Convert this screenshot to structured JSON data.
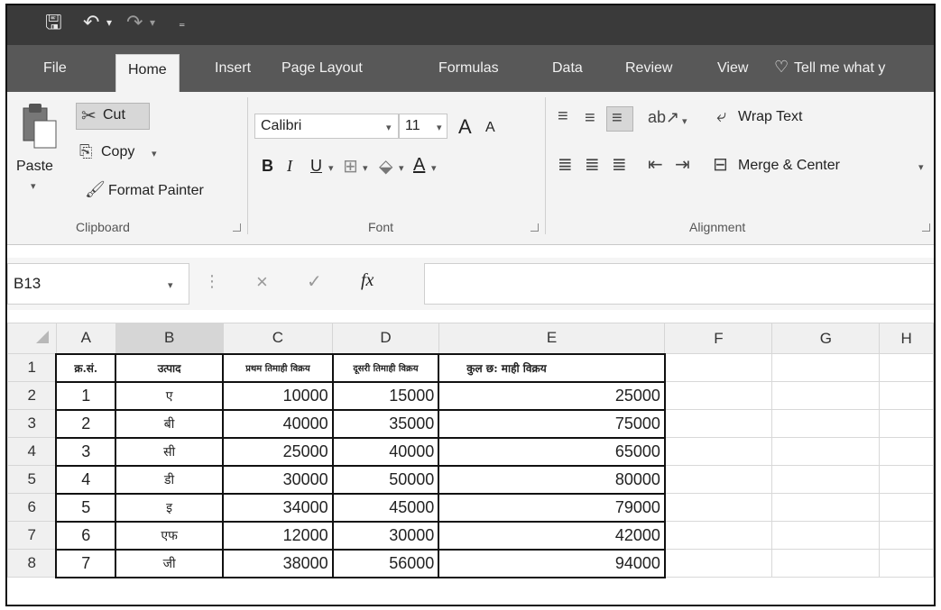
{
  "quick_access": {
    "save_icon": "save-icon",
    "undo_icon": "undo-icon",
    "redo_icon": "redo-icon",
    "customize_icon": "customize-icon"
  },
  "tabs": [
    "File",
    "Home",
    "Insert",
    "Page Layout",
    "Formulas",
    "Data",
    "Review",
    "View"
  ],
  "tell_me": "Tell me what y",
  "clipboard": {
    "paste": "Paste",
    "cut": "Cut",
    "copy": "Copy",
    "format_painter": "Format Painter",
    "label": "Clipboard"
  },
  "font": {
    "name": "Calibri",
    "size": "11",
    "grow": "A",
    "shrink": "A",
    "bold": "B",
    "italic": "I",
    "underline": "U",
    "font_color": "A",
    "label": "Font"
  },
  "alignment": {
    "wrap_text": "Wrap Text",
    "merge_center": "Merge & Center",
    "label": "Alignment"
  },
  "formula_bar": {
    "name_box": "B13",
    "fx": "fx",
    "cancel": "×",
    "enter": "✓",
    "value": ""
  },
  "columns": [
    "A",
    "B",
    "C",
    "D",
    "E",
    "F",
    "G",
    "H"
  ],
  "selected_column": "B",
  "rows": [
    {
      "num": "1",
      "cells": [
        "क्र.सं.",
        "उत्पाद",
        "प्रथम तिमाही विक्रय",
        "दूसरी तिमाही विक्रय",
        "कुल छ: माही विक्रय"
      ]
    },
    {
      "num": "2",
      "cells": [
        "1",
        "ए",
        "10000",
        "15000",
        "25000"
      ]
    },
    {
      "num": "3",
      "cells": [
        "2",
        "बी",
        "40000",
        "35000",
        "75000"
      ]
    },
    {
      "num": "4",
      "cells": [
        "3",
        "सी",
        "25000",
        "40000",
        "65000"
      ]
    },
    {
      "num": "5",
      "cells": [
        "4",
        "डी",
        "30000",
        "50000",
        "80000"
      ]
    },
    {
      "num": "6",
      "cells": [
        "5",
        "इ",
        "34000",
        "45000",
        "79000"
      ]
    },
    {
      "num": "7",
      "cells": [
        "6",
        "एफ",
        "12000",
        "30000",
        "42000"
      ]
    },
    {
      "num": "8",
      "cells": [
        "7",
        "जी",
        "38000",
        "56000",
        "94000"
      ]
    }
  ]
}
